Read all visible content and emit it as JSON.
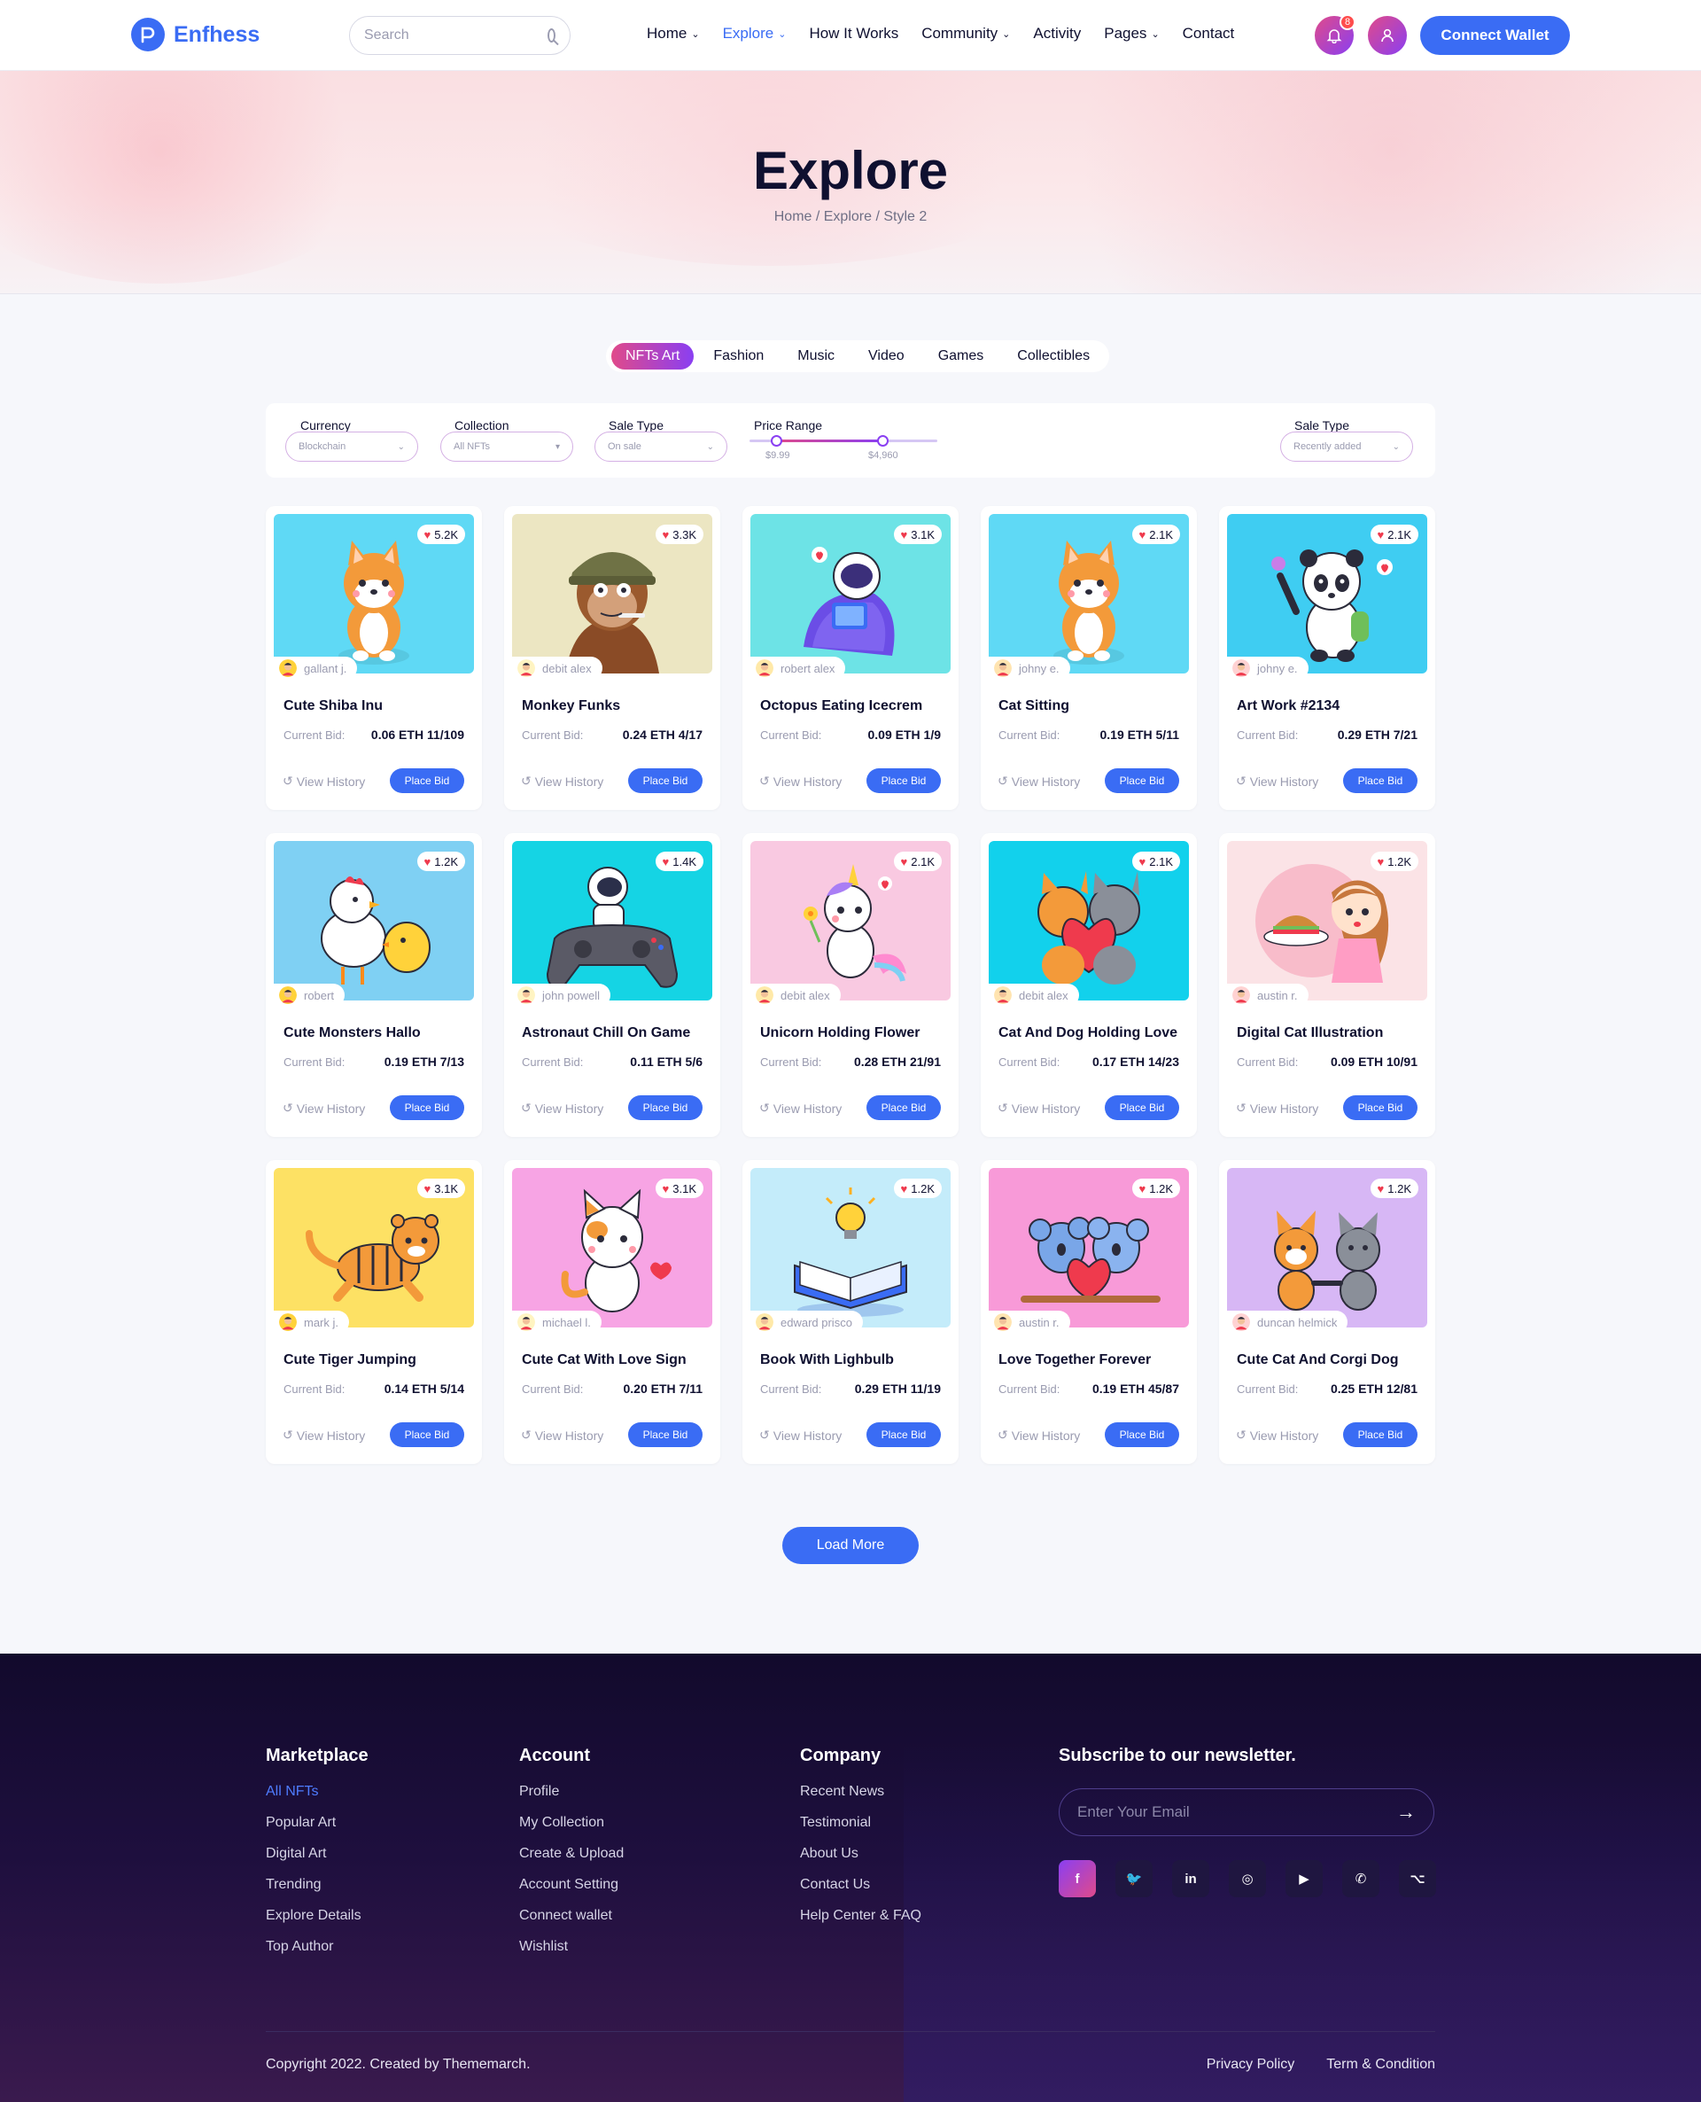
{
  "header": {
    "logo_text": "Enfhess",
    "search_placeholder": "Search",
    "nav": [
      {
        "label": "Home",
        "dropdown": true
      },
      {
        "label": "Explore",
        "dropdown": true,
        "active": true
      },
      {
        "label": "How It Works",
        "dropdown": false
      },
      {
        "label": "Community",
        "dropdown": true
      },
      {
        "label": "Activity",
        "dropdown": false
      },
      {
        "label": "Pages",
        "dropdown": true
      },
      {
        "label": "Contact",
        "dropdown": false
      }
    ],
    "notification_count": "8",
    "connect_label": "Connect Wallet"
  },
  "hero": {
    "title": "Explore",
    "breadcrumb": "Home / Explore / Style 2"
  },
  "tabs": [
    "NFTs Art",
    "Fashion",
    "Music",
    "Video",
    "Games",
    "Collectibles"
  ],
  "active_tab": "NFTs Art",
  "filters": {
    "currency": {
      "label": "Currency",
      "value": "Blockchain"
    },
    "collection": {
      "label": "Collection",
      "value": "All NFTs"
    },
    "sale_type": {
      "label": "Sale Type",
      "value": "On sale"
    },
    "price_range": {
      "label": "Price Range",
      "min": "$9.99",
      "max": "$4,960"
    },
    "sort": {
      "label": "Sale Type",
      "value": "Recently added"
    }
  },
  "card_labels": {
    "current_bid": "Current Bid:",
    "view_history": "View History",
    "place_bid": "Place Bid"
  },
  "cards": [
    {
      "title": "Cute Shiba Inu",
      "owner": "gallant j.",
      "likes": "5.2K",
      "bid": "0.06 ETH 11/109",
      "bg": "#5fd9f5",
      "art": "shiba"
    },
    {
      "title": "Monkey Funks",
      "owner": "debit alex",
      "likes": "3.3K",
      "bid": "0.24 ETH 4/17",
      "bg": "#ece6c2",
      "art": "monkey"
    },
    {
      "title": "Octopus Eating Icecrem",
      "owner": "robert alex",
      "likes": "3.1K",
      "bid": "0.09 ETH 1/9",
      "bg": "#6de3e6",
      "art": "astronaut-book"
    },
    {
      "title": "Cat Sitting",
      "owner": "johny e.",
      "likes": "2.1K",
      "bid": "0.19 ETH 5/11",
      "bg": "#5fd9f5",
      "art": "shiba"
    },
    {
      "title": "Art Work #2134",
      "owner": "johny e.",
      "likes": "2.1K",
      "bid": "0.29 ETH 7/21",
      "bg": "#3fcdf2",
      "art": "panda"
    },
    {
      "title": "Cute Monsters Hallo",
      "owner": "robert",
      "likes": "1.2K",
      "bid": "0.19 ETH 7/13",
      "bg": "#7fd0f3",
      "art": "chicken"
    },
    {
      "title": "Astronaut Chill On Game",
      "owner": "john powell",
      "likes": "1.4K",
      "bid": "0.11 ETH 5/6",
      "bg": "#15d4e4",
      "art": "astronaut-game"
    },
    {
      "title": "Unicorn Holding Flower",
      "owner": "debit alex",
      "likes": "2.1K",
      "bid": "0.28 ETH 21/91",
      "bg": "#f9c9e1",
      "art": "unicorn"
    },
    {
      "title": "Cat And Dog Holding Love",
      "owner": "debit alex",
      "likes": "2.1K",
      "bid": "0.17 ETH 14/23",
      "bg": "#12d1ec",
      "art": "cat-dog"
    },
    {
      "title": "Digital Cat Illustration",
      "owner": "austin r.",
      "likes": "1.2K",
      "bid": "0.09 ETH 10/91",
      "bg": "#fbe3e6",
      "art": "girl"
    },
    {
      "title": "Cute Tiger Jumping",
      "owner": "mark j.",
      "likes": "3.1K",
      "bid": "0.14 ETH 5/14",
      "bg": "#fde164",
      "art": "tiger"
    },
    {
      "title": "Cute Cat With Love Sign",
      "owner": "michael l.",
      "likes": "3.1K",
      "bid": "0.20 ETH 7/11",
      "bg": "#f7a4e4",
      "art": "cat"
    },
    {
      "title": "Book With Lighbulb",
      "owner": "edward prisco",
      "likes": "1.2K",
      "bid": "0.29 ETH 11/19",
      "bg": "#c4ecfa",
      "art": "book"
    },
    {
      "title": "Love Together Forever",
      "owner": "austin r.",
      "likes": "1.2K",
      "bid": "0.19 ETH 45/87",
      "bg": "#f89ad8",
      "art": "koala"
    },
    {
      "title": "Cute Cat And Corgi Dog",
      "owner": "duncan helmick",
      "likes": "1.2K",
      "bid": "0.25 ETH 12/81",
      "bg": "#d7b7f5",
      "art": "corgi-cat"
    }
  ],
  "load_more": "Load More",
  "footer": {
    "columns": [
      {
        "title": "Marketplace",
        "links": [
          "All NFTs",
          "Popular Art",
          "Digital Art",
          "Trending",
          "Explore Details",
          "Top Author"
        ]
      },
      {
        "title": "Account",
        "links": [
          "Profile",
          "My Collection",
          "Create & Upload",
          "Account Setting",
          "Connect wallet",
          "Wishlist"
        ]
      },
      {
        "title": "Company",
        "links": [
          "Recent News",
          "Testimonial",
          "About Us",
          "Contact Us",
          "Help Center & FAQ"
        ]
      }
    ],
    "newsletter_title": "Subscribe to our newsletter.",
    "email_placeholder": "Enter Your Email",
    "socials": [
      "facebook-icon",
      "twitter-icon",
      "linkedin-icon",
      "instagram-icon",
      "youtube-icon",
      "whatsapp-icon",
      "github-icon"
    ],
    "copyright": "Copyright 2022. Created by Thememarch.",
    "legal": [
      "Privacy Policy",
      "Term & Condition"
    ]
  },
  "colors": {
    "accent": "#3a6cf4",
    "gradient_start": "#e04a8a",
    "gradient_end": "#8a3ff2",
    "footer_bg": "#120a2c"
  }
}
